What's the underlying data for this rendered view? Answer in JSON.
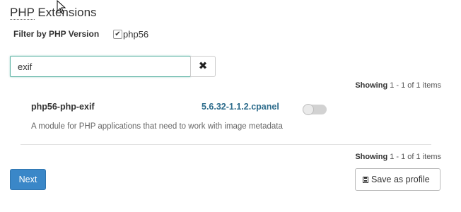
{
  "header": {
    "title_abbr": "PHP",
    "title_rest": "Extensions"
  },
  "filter": {
    "label": "Filter by PHP Version",
    "option_label": "php56",
    "option_checked": true
  },
  "search": {
    "value": "exif",
    "clear_icon": "times-icon"
  },
  "pagination": {
    "showing_label": "Showing",
    "showing_range": "1 - 1 of 1 items"
  },
  "extensions": [
    {
      "name": "php56-php-exif",
      "version": "5.6.32-1.1.2.cpanel",
      "enabled": false,
      "description": "A module for PHP applications that need to work with image metadata"
    }
  ],
  "actions": {
    "next_label": "Next",
    "save_label": "Save as profile",
    "save_icon": "floppy-disk-icon"
  },
  "colors": {
    "primary_button": "#3a87c8",
    "link": "#2d6c8c",
    "input_focus_border": "#5fb4a5",
    "toggle_off": "#d2d2d2"
  }
}
